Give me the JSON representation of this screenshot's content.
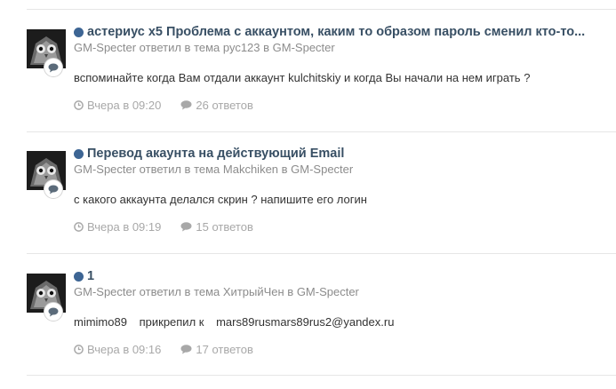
{
  "posts": [
    {
      "title": "астериус x5 Проблема с аккаунтом, каким то образом пароль сменил кто-то...",
      "meta": "GM-Specter ответил в тема рус123 в GM-Specter",
      "body": "вспоминайте когда Вам отдали аккаунт kulchitskiy и когда Вы начали на нем играть ?",
      "time": "Вчера в 09:20",
      "replies": "26 ответов"
    },
    {
      "title": "Перевод акаунта на действующий Email",
      "meta": "GM-Specter ответил в тема Makchiken в GM-Specter",
      "body": "с какого аккаунта делался скрин ? напишите его логин",
      "time": "Вчера в 09:19",
      "replies": "15 ответов"
    },
    {
      "title": "1",
      "meta": "GM-Specter ответил в тема ХитрыйЧен в GM-Specter",
      "body_parts": {
        "user": "mimimo89",
        "action": "прикрепил к",
        "email": "mars89rusmars89rus2@yandex.ru"
      },
      "time": "Вчера в 09:16",
      "replies": "17 ответов"
    }
  ],
  "icons": {
    "clock": "clock-icon",
    "comment": "comment-icon",
    "unread_dot": "unread-dot-icon"
  },
  "colors": {
    "title": "#384f64",
    "unread_dot": "#3d6594",
    "meta": "#8c8c8c",
    "stats": "#a8a8a8"
  }
}
